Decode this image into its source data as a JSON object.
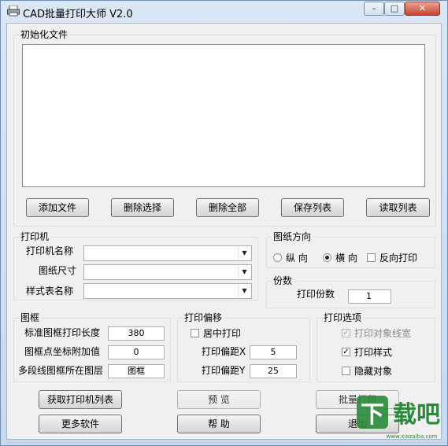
{
  "window": {
    "title": "CAD批量打印大师 V2.0",
    "controls": [
      "minimize",
      "maximize",
      "close"
    ]
  },
  "init_files": {
    "title": "初始化文件",
    "items": []
  },
  "file_buttons": [
    "添加文件",
    "删除选择",
    "删除全部",
    "保存列表",
    "读取列表"
  ],
  "printer": {
    "title": "打印机",
    "printer_name_label": "打印机名称",
    "printer_name_value": "",
    "paper_size_label": "图纸尺寸",
    "paper_size_value": "",
    "style_label": "样式表名称",
    "style_value": ""
  },
  "orientation": {
    "title": "图纸方向",
    "portrait": "纵 向",
    "landscape": "横 向",
    "reverse": "反向打印",
    "selected": "landscape",
    "reverse_checked": false
  },
  "copies": {
    "title": "份数",
    "label": "打印份数",
    "value": "1"
  },
  "frame": {
    "title": "图框",
    "length_label": "标准图框打印长度",
    "length_value": "380",
    "coord_label": "图框点坐标附加值",
    "coord_value": "0",
    "layer_label": "多段线图框所在图层",
    "layer_value": "图框"
  },
  "offset": {
    "title": "打印偏移",
    "center_label": "居中打印",
    "center_checked": false,
    "x_label": "打印偏距X",
    "x_value": "5",
    "y_label": "打印偏距Y",
    "y_value": "25"
  },
  "options": {
    "title": "打印选项",
    "lineweight_label": "打印对象线宽",
    "lineweight_checked": true,
    "lineweight_disabled": true,
    "style_label": "打印样式",
    "style_checked": true,
    "hide_label": "隐藏对象",
    "hide_checked": false
  },
  "bottom_buttons": {
    "get_printers": "获取打印机列表",
    "preview": "预 览",
    "batch_print": "批量打印",
    "more_software": "更多软件",
    "help": "帮 助",
    "exit": "退出"
  },
  "watermark": {
    "text": "下载吧",
    "url": "www.xiazaiba.com"
  },
  "colors": {
    "titlebar": "#c8d9ee",
    "client": "#f0f0f0",
    "watermark": "#2a8a3a"
  }
}
